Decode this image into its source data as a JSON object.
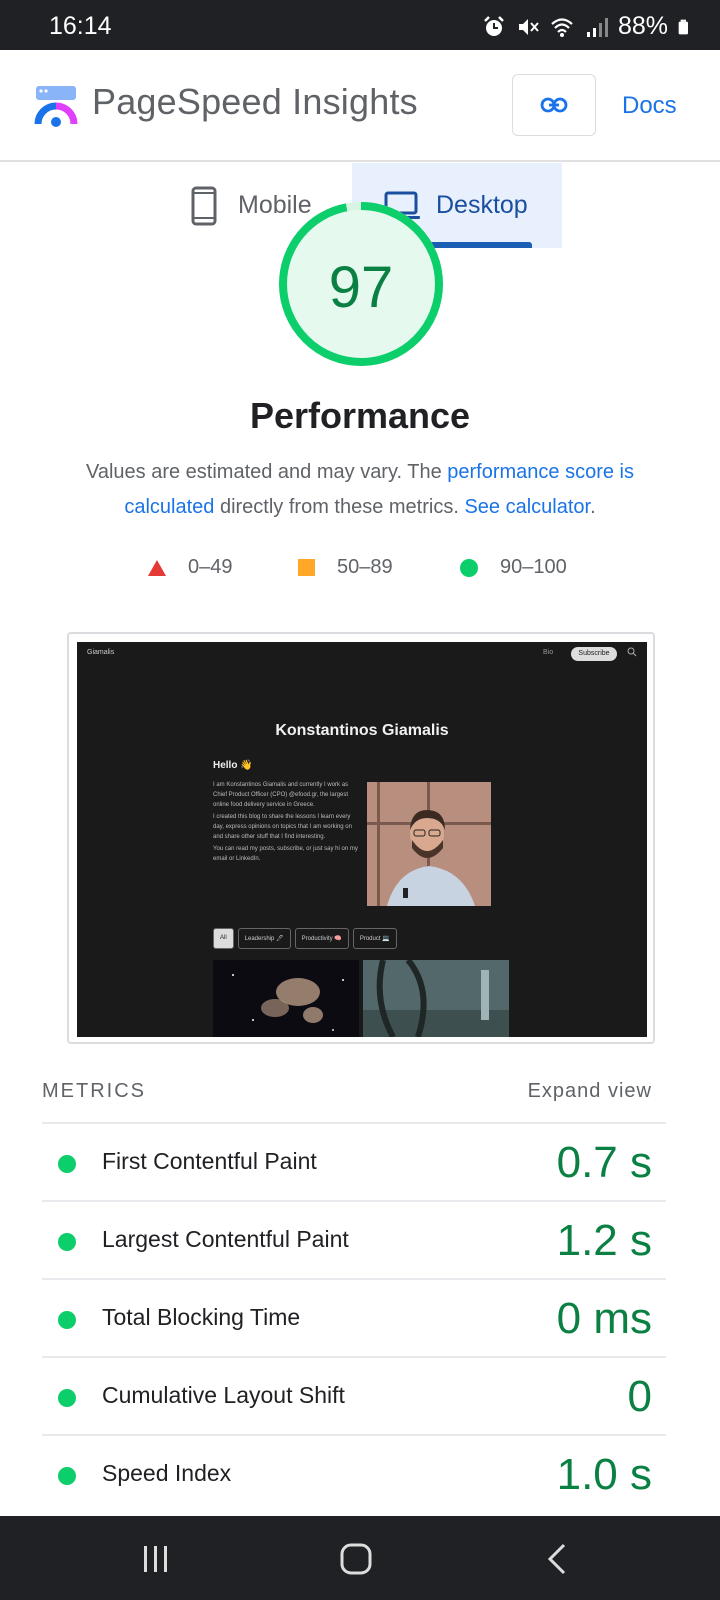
{
  "status_bar": {
    "time": "16:14",
    "battery": "88%"
  },
  "header": {
    "brand": "PageSpeed Insights",
    "docs_label": "Docs"
  },
  "tabs": [
    {
      "label": "Mobile",
      "selected": false
    },
    {
      "label": "Desktop",
      "selected": true
    }
  ],
  "performance": {
    "score": "97",
    "score_fraction": 0.97,
    "title": "Performance",
    "desc_text_1": "Values are estimated and may vary. The ",
    "desc_link_1": "performance score is calculated",
    "desc_text_2": " directly from these metrics. ",
    "desc_link_2": "See calculator",
    "desc_text_3": "."
  },
  "legend": [
    {
      "range": "0–49",
      "shape": "triangle",
      "color": "#e53935"
    },
    {
      "range": "50–89",
      "shape": "square",
      "color": "#ffa726"
    },
    {
      "range": "90–100",
      "shape": "circle",
      "color": "#0cce6b"
    }
  ],
  "screenshot": {
    "site_name": "Giamalis",
    "nav_bio": "Bio",
    "nav_subscribe": "Subscribe",
    "heading": "Konstantinos Giamalis",
    "hello": "Hello 👋",
    "paragraph_1": "I am Konstantinos Giamalis and currently I work as Chief Product Officer (CPO) @efood.gr, the largest online food delivery service in Greece.",
    "paragraph_2": "I created this blog to share the lessons I learn every day, express opinions on topics that I am working on and share other stuff that I find interesting.",
    "paragraph_3": "You can read my posts, subscribe, or just say hi on my email or LinkedIn.",
    "chips": [
      "All",
      "Leadership 🖊",
      "Productivity 🧠",
      "Product 💻"
    ]
  },
  "metrics": {
    "heading": "METRICS",
    "expand_label": "Expand view",
    "items": [
      {
        "name": "First Contentful Paint",
        "value": "0.7 s"
      },
      {
        "name": "Largest Contentful Paint",
        "value": "1.2 s"
      },
      {
        "name": "Total Blocking Time",
        "value": "0 ms"
      },
      {
        "name": "Cumulative Layout Shift",
        "value": "0"
      },
      {
        "name": "Speed Index",
        "value": "1.0 s"
      }
    ]
  },
  "colors": {
    "good": "#0cce6b",
    "good_text": "#0b8043",
    "link": "#1a73e8",
    "tab_selected_bg": "#e8f0fe"
  },
  "icons": [
    "alarm-icon",
    "mute-icon",
    "wifi-icon",
    "signal-icon",
    "battery-icon",
    "link-icon",
    "phone-icon",
    "laptop-icon",
    "recent-apps-icon",
    "home-icon",
    "back-icon"
  ]
}
